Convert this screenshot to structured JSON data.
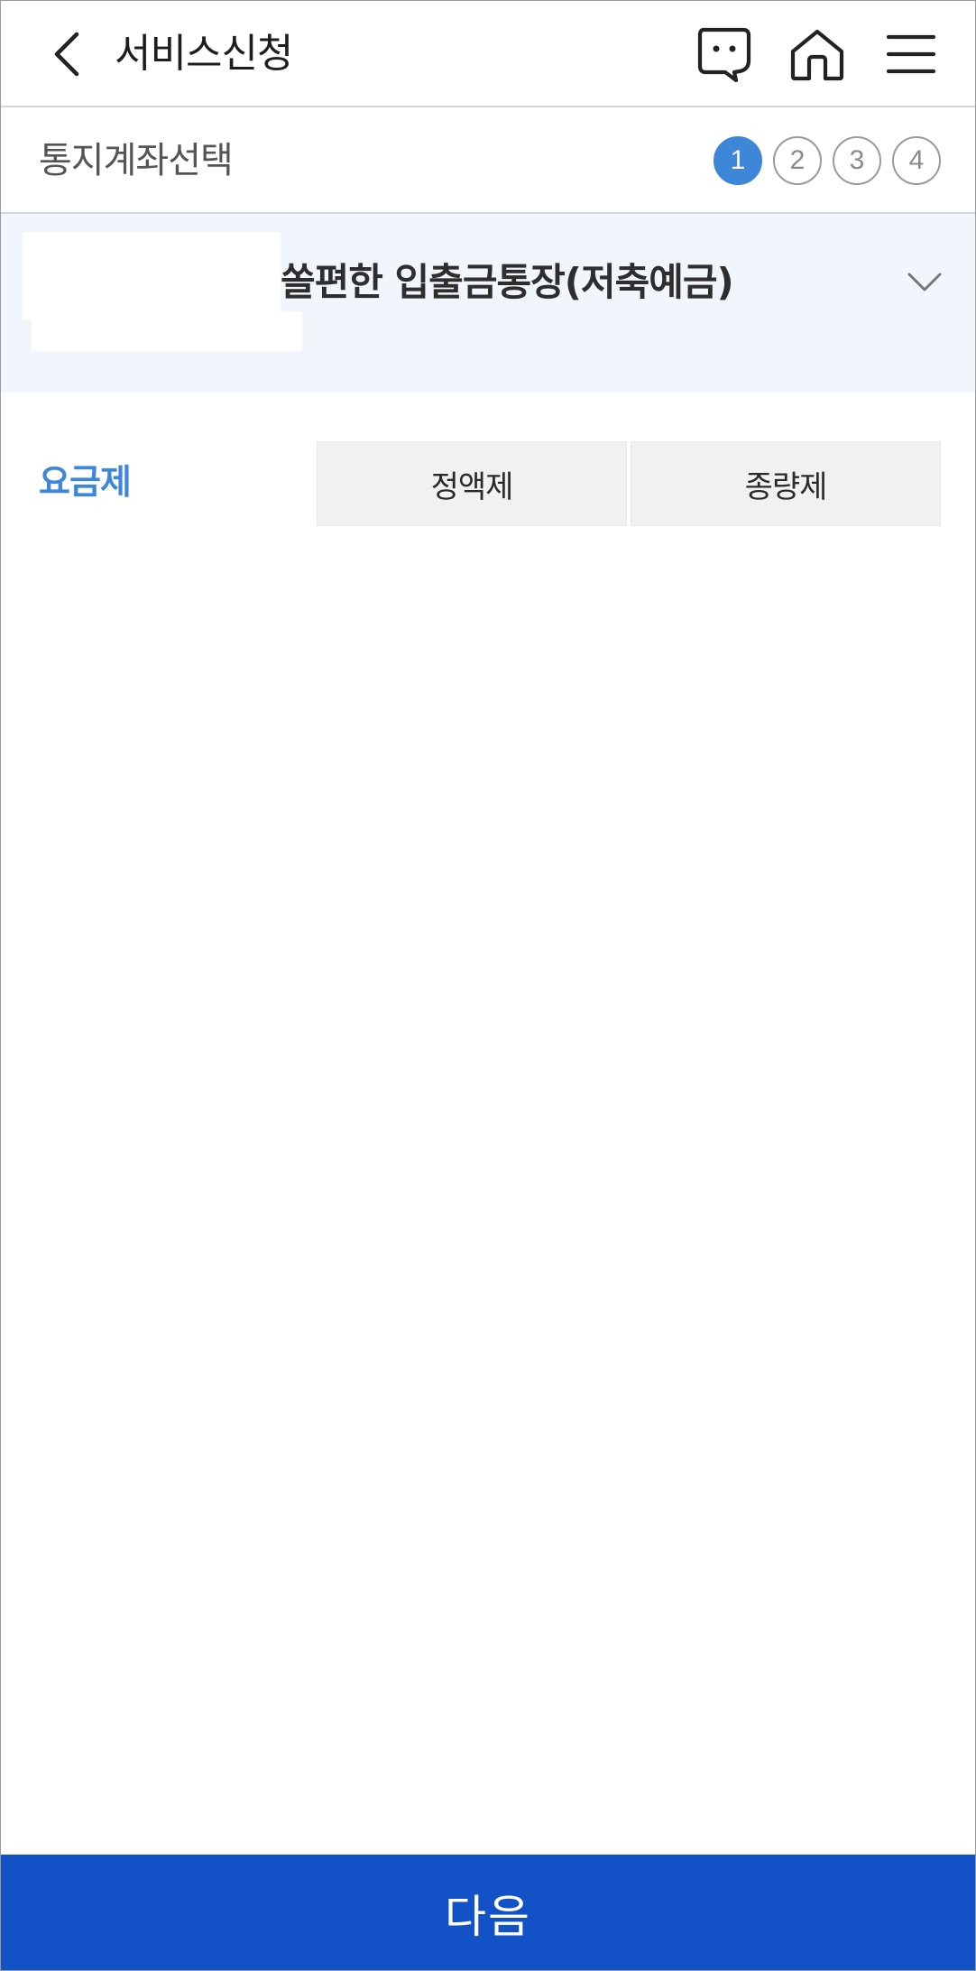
{
  "header": {
    "title": "서비스신청",
    "icons": {
      "back": "chevron-left-icon",
      "chat": "chat-bubble-icon",
      "home": "home-icon",
      "menu": "hamburger-menu-icon"
    }
  },
  "stepbar": {
    "title": "통지계좌선택",
    "steps": [
      "1",
      "2",
      "3",
      "4"
    ],
    "active_step": 1
  },
  "account": {
    "name": "쏠편한 입출금통장(저축예금)",
    "icon": "chevron-down-icon"
  },
  "plan": {
    "label": "요금제",
    "options": [
      "정액제",
      "종량제"
    ]
  },
  "footer": {
    "next_label": "다음"
  },
  "colors": {
    "accent": "#3e86d8",
    "primary_button": "#1352c6",
    "account_bg": "#f1f6fd",
    "option_bg": "#f1f1f1"
  }
}
